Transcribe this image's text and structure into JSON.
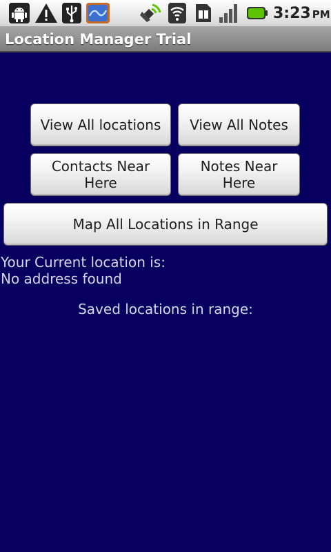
{
  "status_bar": {
    "icons": [
      "android-debug-icon",
      "warning-icon",
      "usb-icon",
      "app-notification-icon",
      "gps-icon",
      "wifi-icon",
      "sim-card-icon",
      "signal-icon",
      "battery-icon"
    ],
    "time": "3:23",
    "ampm": "PM"
  },
  "app": {
    "title": "Location Manager Trial"
  },
  "buttons": {
    "view_all_locations": "View All locations",
    "view_all_notes": "View All Notes",
    "contacts_near_here": "Contacts Near Here",
    "notes_near_here": "Notes Near Here",
    "map_all_locations": "Map All Locations in Range"
  },
  "content": {
    "current_location_label": "Your Current location is:",
    "current_location_value": "No address found",
    "saved_locations_label": "Saved locations in range:"
  },
  "colors": {
    "background": "#07005e",
    "text": "#d6d6ea",
    "battery": "#5cc400"
  }
}
